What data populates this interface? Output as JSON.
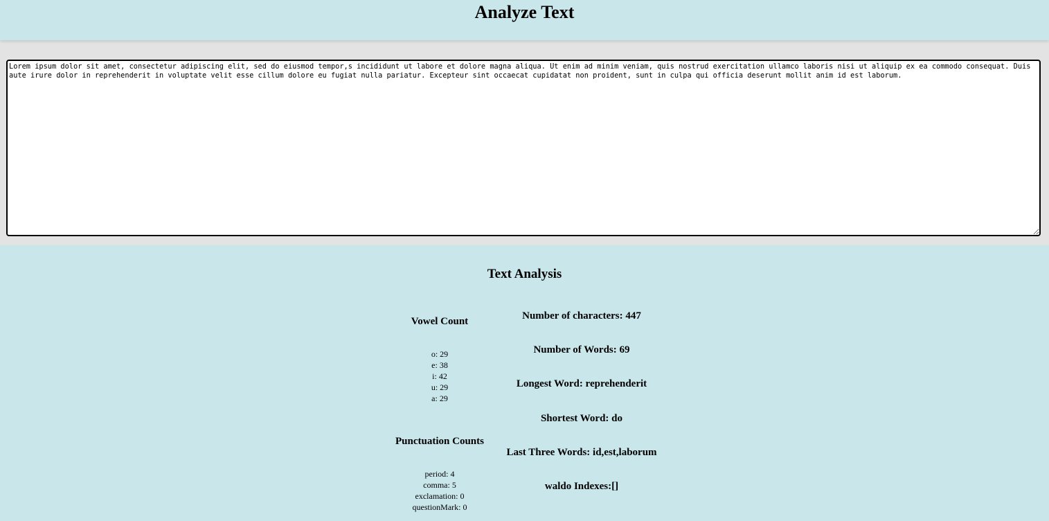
{
  "header": {
    "title": "Analyze Text"
  },
  "editor": {
    "value": "Lorem ipsum dolor sit amet, consectetur adipiscing elit, sed do eiusmod tempor,s incididunt ut labore et dolore magna aliqua. Ut enim ad minim veniam, quis nostrud exercitation ullamco laboris nisi ut aliquip ex ea commodo consequat. Duis aute irure dolor in reprehenderit in voluptate velit esse cillum dolore eu fugiat nulla pariatur. Excepteur sint occaecat cupidatat non proident, sunt in culpa qui officia deserunt mollit anim id est laborum."
  },
  "analysis": {
    "title": "Text Analysis",
    "vowels": {
      "heading": "Vowel Count",
      "items": [
        "o: 29",
        "e: 38",
        "i: 42",
        "u: 29",
        "a: 29"
      ]
    },
    "punctuation": {
      "heading": "Punctuation Counts",
      "items": [
        "period: 4",
        "comma: 5",
        "exclamation: 0",
        "questionMark: 0"
      ]
    },
    "stats": {
      "characters": "Number of characters: 447",
      "words": "Number of Words: 69",
      "longest": "Longest Word: reprehenderit",
      "shortest": "Shortest Word: do",
      "last_three": "Last Three Words: id,est,laborum",
      "waldo": "waldo Indexes:[]"
    }
  }
}
